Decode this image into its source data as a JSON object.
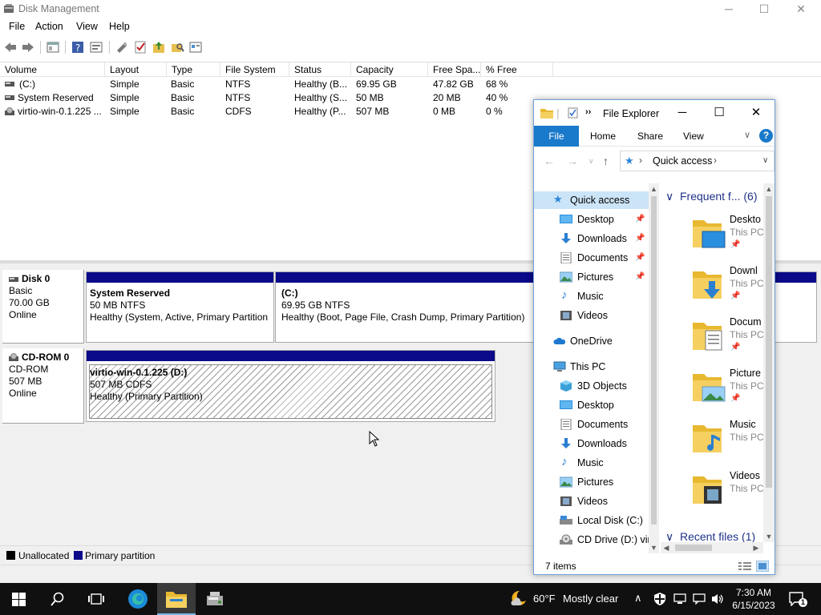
{
  "disk_management": {
    "title": "Disk Management",
    "window_controls": {
      "minimize": "─",
      "maximize": "☐",
      "close": "✕"
    },
    "menu": [
      "File",
      "Action",
      "View",
      "Help"
    ],
    "columns": [
      "Volume",
      "Layout",
      "Type",
      "File System",
      "Status",
      "Capacity",
      "Free Spa...",
      "% Free"
    ],
    "volumes": [
      {
        "volume": "(C:)",
        "layout": "Simple",
        "type": "Basic",
        "fs": "NTFS",
        "status": "Healthy (B...",
        "capacity": "69.95 GB",
        "free": "47.82 GB",
        "pct": "68 %"
      },
      {
        "volume": "System Reserved",
        "layout": "Simple",
        "type": "Basic",
        "fs": "NTFS",
        "status": "Healthy (S...",
        "capacity": "50 MB",
        "free": "20 MB",
        "pct": "40 %"
      },
      {
        "volume": "virtio-win-0.1.225 ...",
        "layout": "Simple",
        "type": "Basic",
        "fs": "CDFS",
        "status": "Healthy (P...",
        "capacity": "507 MB",
        "free": "0 MB",
        "pct": "0 %"
      }
    ],
    "disks": [
      {
        "name": "Disk 0",
        "kind": "Basic",
        "size": "70.00 GB",
        "state": "Online",
        "partitions": [
          {
            "name": "System Reserved",
            "size": "50 MB NTFS",
            "status": "Healthy (System, Active, Primary Partition"
          },
          {
            "name": "(C:)",
            "size": "69.95 GB NTFS",
            "status": "Healthy (Boot, Page File, Crash Dump, Primary Partition)"
          }
        ]
      },
      {
        "name": "CD-ROM 0",
        "kind": "CD-ROM",
        "size": "507 MB",
        "state": "Online",
        "partitions": [
          {
            "name": "virtio-win-0.1.225  (D:)",
            "size": "507 MB CDFS",
            "status": "Healthy (Primary Partition)"
          }
        ]
      }
    ],
    "legend": [
      {
        "label": "Unallocated",
        "color": "#000000"
      },
      {
        "label": "Primary partition",
        "color": "#0a0a8a"
      }
    ]
  },
  "file_explorer": {
    "title": "File Explorer",
    "qat_more": "››",
    "window_controls": {
      "minimize": "─",
      "maximize": "☐",
      "close": "✕"
    },
    "ribbon_tabs": [
      "File",
      "Home",
      "Share",
      "View"
    ],
    "help": "?",
    "address": {
      "location": "Quick access"
    },
    "nav_items": [
      {
        "label": "Quick access",
        "icon": "star-icon",
        "pinned": false
      },
      {
        "label": "Desktop",
        "icon": "desktop-icon",
        "pinned": true
      },
      {
        "label": "Downloads",
        "icon": "download-icon",
        "pinned": true
      },
      {
        "label": "Documents",
        "icon": "document-icon",
        "pinned": true
      },
      {
        "label": "Pictures",
        "icon": "pictures-icon",
        "pinned": true
      },
      {
        "label": "Music",
        "icon": "music-icon",
        "pinned": false
      },
      {
        "label": "Videos",
        "icon": "videos-icon",
        "pinned": false
      },
      {
        "label": "OneDrive",
        "icon": "cloud-icon",
        "pinned": false
      },
      {
        "label": "This PC",
        "icon": "computer-icon",
        "pinned": false
      },
      {
        "label": "3D Objects",
        "icon": "cube-icon",
        "pinned": false
      },
      {
        "label": "Desktop",
        "icon": "desktop-icon",
        "pinned": false
      },
      {
        "label": "Documents",
        "icon": "document-icon",
        "pinned": false
      },
      {
        "label": "Downloads",
        "icon": "download-icon",
        "pinned": false
      },
      {
        "label": "Music",
        "icon": "music-icon",
        "pinned": false
      },
      {
        "label": "Pictures",
        "icon": "pictures-icon",
        "pinned": false
      },
      {
        "label": "Videos",
        "icon": "videos-icon",
        "pinned": false
      },
      {
        "label": "Local Disk (C:)",
        "icon": "drive-icon",
        "pinned": false
      },
      {
        "label": "CD Drive (D:) virt",
        "icon": "cd-icon",
        "pinned": false
      }
    ],
    "frequent_header": "Frequent f... (6)",
    "recent_header": "Recent files (1)",
    "frequent_items": [
      {
        "name": "Deskto",
        "sub": "This PC",
        "pinned": true
      },
      {
        "name": "Downl",
        "sub": "This PC",
        "pinned": true
      },
      {
        "name": "Docum",
        "sub": "This PC",
        "pinned": true
      },
      {
        "name": "Picture",
        "sub": "This PC",
        "pinned": true
      },
      {
        "name": "Music",
        "sub": "This PC",
        "pinned": false
      },
      {
        "name": "Videos",
        "sub": "This PC",
        "pinned": false
      }
    ],
    "status": "7 items"
  },
  "taskbar": {
    "weather_temp": "60°F",
    "weather_text": "Mostly clear",
    "time": "7:30 AM",
    "date": "6/15/2023"
  },
  "colors": {
    "primary_partition": "#0a0a8a",
    "explorer_accent": "#1979ca",
    "taskbar": "#101010"
  }
}
